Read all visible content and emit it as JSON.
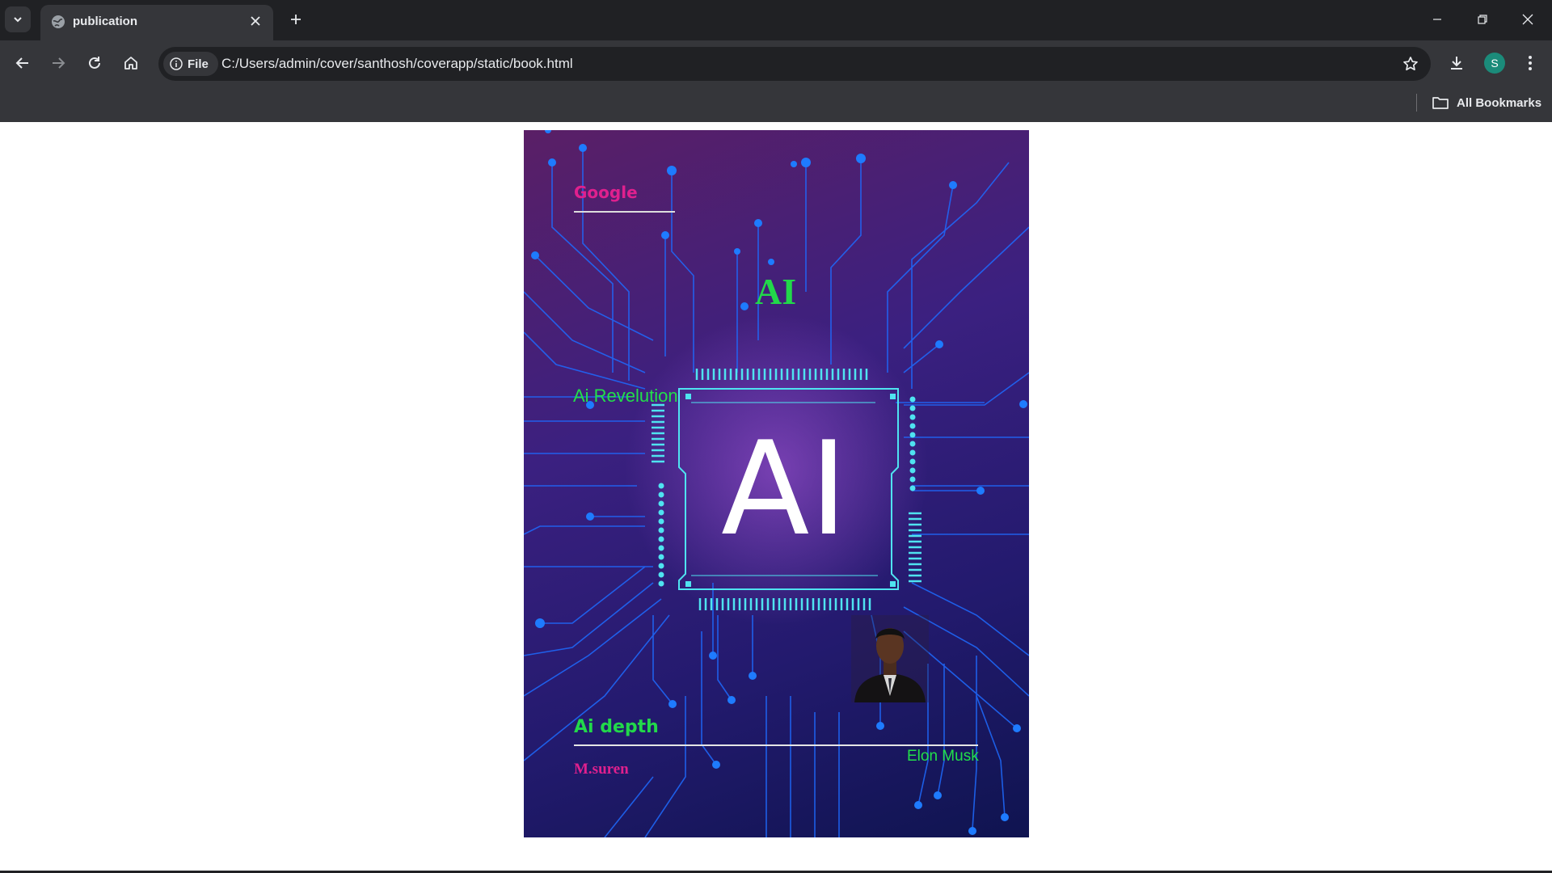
{
  "browser": {
    "tab_title": "publication",
    "url": "C:/Users/admin/cover/santhosh/coverapp/static/book.html",
    "protocol_chip": "File",
    "bookmarks_label": "All Bookmarks",
    "avatar_letter": "S",
    "avatar_color": "#1b8b7a"
  },
  "cover": {
    "publisher": "Google",
    "main_heading": "AI",
    "subtitle": "Ai Revelution",
    "chip_text": "AI",
    "book_title": "Ai depth",
    "author": "M.suren",
    "dedication": "Elon Musk",
    "colors": {
      "pink": "#e0208e",
      "green": "#22d84a",
      "circuit": "#1e6bff",
      "chip": "#4fe3f0"
    }
  }
}
